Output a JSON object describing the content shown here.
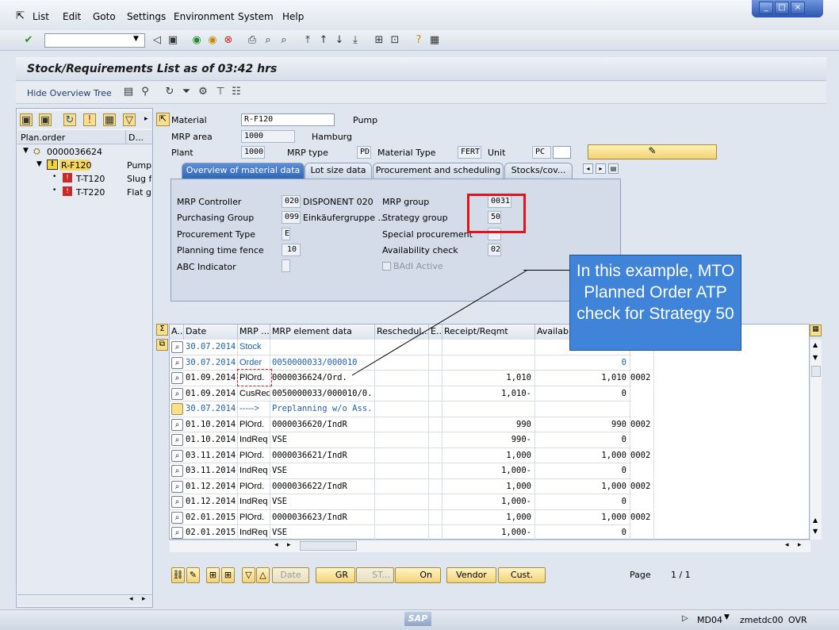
{
  "menu": {
    "items": [
      "List",
      "Edit",
      "Goto",
      "Settings",
      "Environment",
      "System",
      "Help"
    ]
  },
  "title": "Stock/Requirements List as of 03:42 hrs",
  "app_toolbar": {
    "hide_tree": "Hide Overview Tree"
  },
  "tree": {
    "col1": "Plan.order",
    "col2": "D...",
    "nodes": [
      {
        "label": "0000036624",
        "desc": ""
      },
      {
        "label": "R-F120",
        "desc": "Pump"
      },
      {
        "label": "T-T120",
        "desc": "Slug fo"
      },
      {
        "label": "T-T220",
        "desc": "Flat ga"
      }
    ]
  },
  "header": {
    "material_label": "Material",
    "material_value": "R-F120",
    "material_desc": "Pump",
    "mrp_area_label": "MRP area",
    "mrp_area_value": "1000",
    "mrp_area_desc": "Hamburg",
    "plant_label": "Plant",
    "plant_value": "1000",
    "mrp_type_label": "MRP type",
    "mrp_type_value": "PD",
    "mat_type_label": "Material Type",
    "mat_type_value": "FERT",
    "unit_label": "Unit",
    "unit_value": "PC"
  },
  "tabs": [
    "Overview of material data",
    "Lot size data",
    "Procurement and scheduling",
    "Stocks/cov..."
  ],
  "overview": {
    "mrp_controller_label": "MRP Controller",
    "mrp_controller_value": "020",
    "mrp_controller_desc": "DISPONENT 020",
    "purch_group_label": "Purchasing Group",
    "purch_group_value": "099",
    "purch_group_desc": "Einkäufergruppe ...",
    "proc_type_label": "Procurement Type",
    "proc_type_value": "E",
    "ptf_label": "Planning time fence",
    "ptf_value": "10",
    "abc_label": "ABC Indicator",
    "abc_value": "",
    "mrp_group_label": "MRP group",
    "mrp_group_value": "0031",
    "strategy_label": "Strategy group",
    "strategy_value": "50",
    "special_proc_label": "Special procurement",
    "special_proc_value": "",
    "avail_label": "Availability check",
    "avail_value": "02",
    "badi_label": "BAdI Active"
  },
  "grid": {
    "headers": [
      "A..",
      "Date",
      "MRP ...",
      "MRP element data",
      "Reschedul...",
      "E..",
      "Receipt/Reqmt",
      "Available ..."
    ],
    "rows": [
      {
        "date": "30.07.2014",
        "mrp": "Stock",
        "data": "",
        "receipt": "",
        "avail": "",
        "extra": "",
        "blue": true
      },
      {
        "date": "30.07.2014",
        "mrp": "Order",
        "data": "0050000033/000010",
        "receipt": "",
        "avail": "0",
        "extra": "",
        "blue": true
      },
      {
        "date": "01.09.2014",
        "mrp": "PlOrd.",
        "data": "0000036624/Ord.",
        "receipt": "1,010",
        "avail": "1,010",
        "extra": "0002",
        "blue": false
      },
      {
        "date": "01.09.2014",
        "mrp": "CusReq",
        "data": "0050000033/000010/0...",
        "receipt": "1,010-",
        "avail": "0",
        "extra": "",
        "blue": false
      },
      {
        "date": "30.07.2014",
        "mrp": "----->",
        "data": "Preplanning w/o Ass...",
        "receipt": "",
        "avail": "",
        "extra": "",
        "blue": true
      },
      {
        "date": "01.10.2014",
        "mrp": "PlOrd.",
        "data": "0000036620/IndR",
        "receipt": "990",
        "avail": "990",
        "extra": "0002",
        "blue": false
      },
      {
        "date": "01.10.2014",
        "mrp": "IndReq",
        "data": "VSE",
        "receipt": "990-",
        "avail": "0",
        "extra": "",
        "blue": false
      },
      {
        "date": "03.11.2014",
        "mrp": "PlOrd.",
        "data": "0000036621/IndR",
        "receipt": "1,000",
        "avail": "1,000",
        "extra": "0002",
        "blue": false
      },
      {
        "date": "03.11.2014",
        "mrp": "IndReq",
        "data": "VSE",
        "receipt": "1,000-",
        "avail": "0",
        "extra": "",
        "blue": false
      },
      {
        "date": "01.12.2014",
        "mrp": "PlOrd.",
        "data": "0000036622/IndR",
        "receipt": "1,000",
        "avail": "1,000",
        "extra": "0002",
        "blue": false
      },
      {
        "date": "01.12.2014",
        "mrp": "IndReq",
        "data": "VSE",
        "receipt": "1,000-",
        "avail": "0",
        "extra": "",
        "blue": false
      },
      {
        "date": "02.01.2015",
        "mrp": "PlOrd.",
        "data": "0000036623/IndR",
        "receipt": "1,000",
        "avail": "1,000",
        "extra": "0002",
        "blue": false
      },
      {
        "date": "02.01.2015",
        "mrp": "IndReq",
        "data": "VSE",
        "receipt": "1,000-",
        "avail": "0",
        "extra": "",
        "blue": false
      }
    ]
  },
  "buttons": {
    "date": "Date",
    "gr": "GR",
    "st": "ST...",
    "on": "On",
    "vendor": "Vendor",
    "cust": "Cust.",
    "page_label": "Page",
    "page_value": "1 / 1"
  },
  "callout": "In this example, MTO Planned Order ATP check for Strategy 50",
  "status": {
    "tcode": "MD04",
    "server": "zmetdc00",
    "mode": "OVR",
    "sap": "SAP"
  },
  "colors": {
    "accent": "#2f66b6",
    "callout": "#3f84d8",
    "highlight": "#e0141e"
  }
}
